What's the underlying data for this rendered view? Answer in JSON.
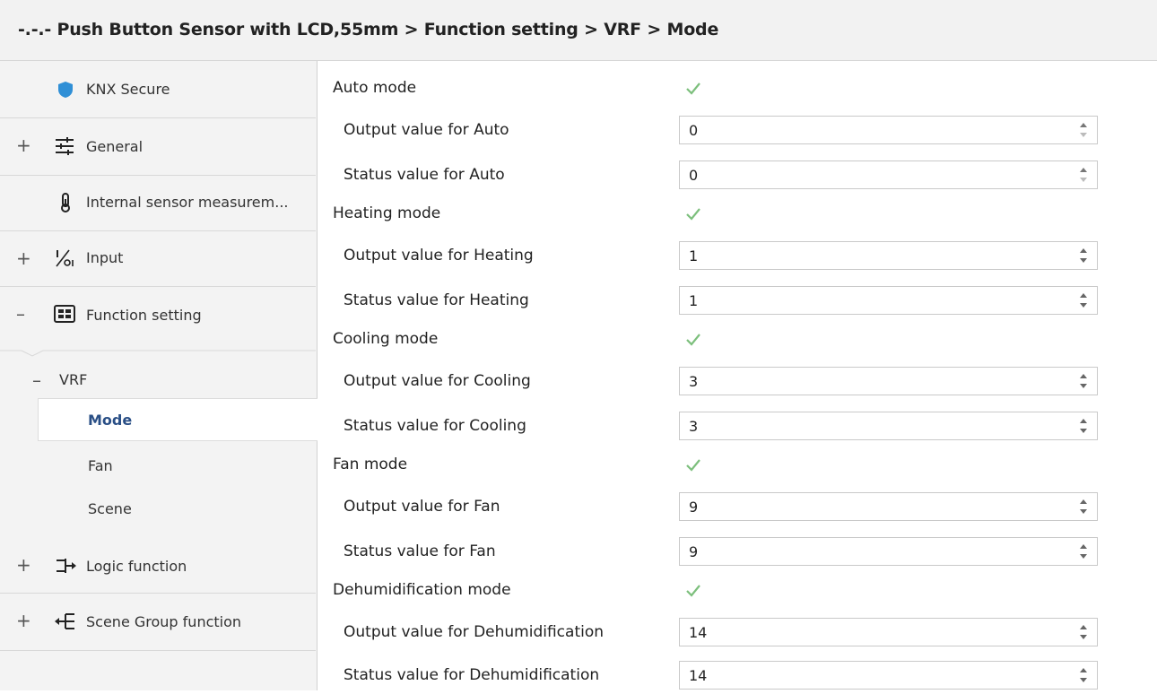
{
  "window": {
    "breadcrumb": "-.-.- Push Button Sensor with LCD,55mm > Function setting > VRF > Mode"
  },
  "sidebar": {
    "items": [
      {
        "label": "KNX Secure",
        "expander": "",
        "icon": "shield-icon"
      },
      {
        "label": "General",
        "expander": "+",
        "icon": "sliders-icon"
      },
      {
        "label": "Internal sensor measurem...",
        "expander": "",
        "icon": "thermometer-icon"
      },
      {
        "label": "Input",
        "expander": "+",
        "icon": "input-icon"
      },
      {
        "label": "Function setting",
        "expander": "–",
        "icon": "function-grid-icon"
      },
      {
        "label": "VRF",
        "expander": "–"
      },
      {
        "label": "Mode"
      },
      {
        "label": "Fan"
      },
      {
        "label": "Scene"
      },
      {
        "label": "Logic function",
        "expander": "+",
        "icon": "logic-icon"
      },
      {
        "label": "Scene Group function",
        "expander": "+",
        "icon": "scene-group-icon"
      }
    ]
  },
  "main": {
    "rows": [
      {
        "label": "Auto mode",
        "type": "checkbox",
        "checked": true
      },
      {
        "label": "Output value for Auto",
        "type": "spin",
        "value": "0"
      },
      {
        "label": "Status value for Auto",
        "type": "spin",
        "value": "0"
      },
      {
        "label": "Heating mode",
        "type": "checkbox",
        "checked": true
      },
      {
        "label": "Output value for Heating",
        "type": "spin",
        "value": "1"
      },
      {
        "label": "Status value for Heating",
        "type": "spin",
        "value": "1"
      },
      {
        "label": "Cooling mode",
        "type": "checkbox",
        "checked": true
      },
      {
        "label": "Output value for Cooling",
        "type": "spin",
        "value": "3"
      },
      {
        "label": "Status value for Cooling",
        "type": "spin",
        "value": "3"
      },
      {
        "label": "Fan mode",
        "type": "checkbox",
        "checked": true
      },
      {
        "label": "Output value for Fan",
        "type": "spin",
        "value": "9"
      },
      {
        "label": "Status value for Fan",
        "type": "spin",
        "value": "9"
      },
      {
        "label": "Dehumidification mode",
        "type": "checkbox",
        "checked": true
      },
      {
        "label": "Output value for Dehumidification",
        "type": "spin",
        "value": "14"
      },
      {
        "label": "Status value for Dehumidification",
        "type": "spin",
        "value": "14"
      }
    ]
  },
  "colors": {
    "active_text": "#2a4f86",
    "shield": "#2f8fd6",
    "check": "#7cbf7c"
  }
}
